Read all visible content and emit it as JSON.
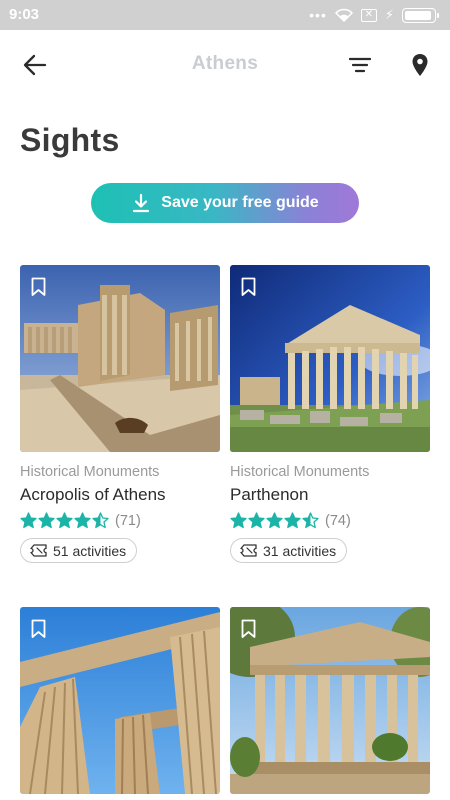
{
  "status_bar": {
    "time": "9:03",
    "dots": "•••",
    "battery_level": 0.95,
    "icons": [
      "wifi-icon",
      "sim-x-icon",
      "charging-icon",
      "battery-icon"
    ]
  },
  "header": {
    "title": "Athens",
    "back_icon": "arrow-left-icon",
    "filter_icon": "filter-icon",
    "map_icon": "map-pin-icon"
  },
  "page": {
    "title": "Sights",
    "save_button": "Save your free guide"
  },
  "colors": {
    "accent_teal": "#1ec0b4",
    "accent_purple": "#a078d8",
    "star": "#1db4a8"
  },
  "cards": [
    {
      "category": "Historical Monuments",
      "title": "Acropolis of Athens",
      "rating": 4.5,
      "review_count": "(71)",
      "activities": "51 activities"
    },
    {
      "category": "Historical Monuments",
      "title": "Parthenon",
      "rating": 4.5,
      "review_count": "(74)",
      "activities": "31 activities"
    },
    {
      "category": "",
      "title": "",
      "rating": null,
      "review_count": "",
      "activities": ""
    },
    {
      "category": "",
      "title": "",
      "rating": null,
      "review_count": "",
      "activities": ""
    }
  ]
}
